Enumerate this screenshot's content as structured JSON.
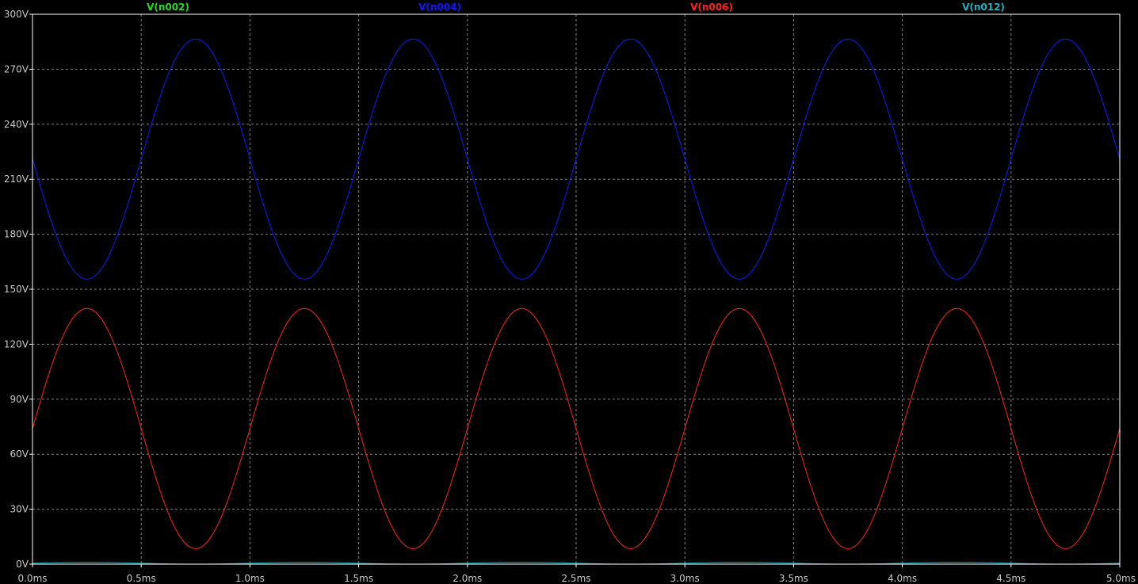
{
  "chart_data": {
    "type": "line",
    "title": "",
    "xlabel": "",
    "ylabel": "",
    "xlim": [
      0.0,
      5.0
    ],
    "ylim": [
      0,
      300
    ],
    "grid": true,
    "legend_position": "top",
    "x_ticks": [
      0.0,
      0.5,
      1.0,
      1.5,
      2.0,
      2.5,
      3.0,
      3.5,
      4.0,
      4.5,
      5.0
    ],
    "x_tick_labels": [
      "0.0ms",
      "0.5ms",
      "1.0ms",
      "1.5ms",
      "2.0ms",
      "2.5ms",
      "3.0ms",
      "3.5ms",
      "4.0ms",
      "4.5ms",
      "5.0ms"
    ],
    "y_ticks": [
      0,
      30,
      60,
      90,
      120,
      150,
      180,
      210,
      240,
      270,
      300
    ],
    "y_tick_labels": [
      "0V",
      "30V",
      "60V",
      "90V",
      "120V",
      "150V",
      "180V",
      "210V",
      "240V",
      "270V",
      "300V"
    ],
    "background": "#000000",
    "grid_color": "#808080",
    "axis_color": "#ffffff",
    "x_unit": "ms",
    "y_unit": "V",
    "series": [
      {
        "name": "V(n002)",
        "color": "#22dd22",
        "waveform": "none",
        "offset": 0,
        "amplitude": 0,
        "period": 1.0,
        "min": 0,
        "max": 0
      },
      {
        "name": "V(n004)",
        "color": "#1414ff",
        "waveform": "sine",
        "offset": 221,
        "amplitude": 65.5,
        "period": 1.0,
        "phase_deg": 180,
        "min": 155.5,
        "max": 286.5
      },
      {
        "name": "V(n006)",
        "color": "#ff2020",
        "waveform": "sine",
        "offset": 74,
        "amplitude": 65.5,
        "period": 1.0,
        "phase_deg": 0,
        "min": 8.5,
        "max": 139.5
      },
      {
        "name": "V(n012)",
        "color": "#20b0c0",
        "waveform": "sine",
        "offset": 0.5,
        "amplitude": 0.5,
        "period": 1.0,
        "phase_deg": 0,
        "min": 0,
        "max": 1
      }
    ]
  }
}
